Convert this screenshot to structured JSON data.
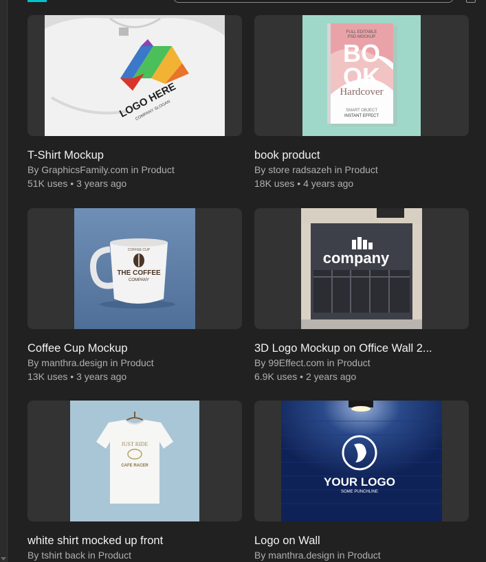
{
  "templates": [
    {
      "title": "T-Shirt Mockup",
      "author": "GraphicsFamily.com",
      "category": "Product",
      "uses": "51K uses",
      "age": "3 years ago",
      "image": "white-tshirt-with-colorful-logo"
    },
    {
      "title": "book product",
      "author": "store radsazeh",
      "category": "Product",
      "uses": "18K uses",
      "age": "4 years ago",
      "image": "hardcover-book-mockup"
    },
    {
      "title": "Coffee Cup Mockup",
      "author": "manthra.design",
      "category": "Product",
      "uses": "13K uses",
      "age": "3 years ago",
      "image": "white-coffee-mug"
    },
    {
      "title": "3D Logo Mockup on Office Wall 2...",
      "author": "99Effect.com",
      "category": "Product",
      "uses": "6.9K uses",
      "age": "2 years ago",
      "image": "office-storefront-sign"
    },
    {
      "title": "white shirt mocked up front",
      "author": "tshirt back",
      "category": "Product",
      "uses": "",
      "age": "",
      "image": "white-shirt-on-hanger"
    },
    {
      "title": "Logo on Wall",
      "author": "manthra.design",
      "category": "Product",
      "uses": "",
      "age": "",
      "image": "logo-on-blue-brick-wall"
    }
  ],
  "book": {
    "line1": "FULL EDITABLE",
    "line2": "PSD MOCKUP",
    "big1": "BO",
    "big2": "OK",
    "sub": "Hardcover",
    "small1": "SMART OBJECT",
    "small2": "INSTANT EFFECT"
  },
  "tshirt_logo": {
    "text": "LOGO HERE",
    "slogan": "COMPANY SLOGAN"
  },
  "mug_logo": {
    "arc": "COFFEE CUP",
    "name": "THE COFFEE",
    "sub": "COMPANY"
  },
  "store_sign": "company",
  "shirt2_print": {
    "line1": "JUST RIDE",
    "line2": "CAFE RACER"
  },
  "wall_logo": {
    "text": "YOUR LOGO",
    "sub": "SOME PUNCHLINE"
  },
  "labels": {
    "by": "By ",
    "in": " in ",
    "dot": " • "
  },
  "colors": {
    "background": "#212121",
    "card": "#333333",
    "title": "#f2f2f2",
    "meta": "#b0b0b0",
    "accent": "#00c4cc"
  }
}
